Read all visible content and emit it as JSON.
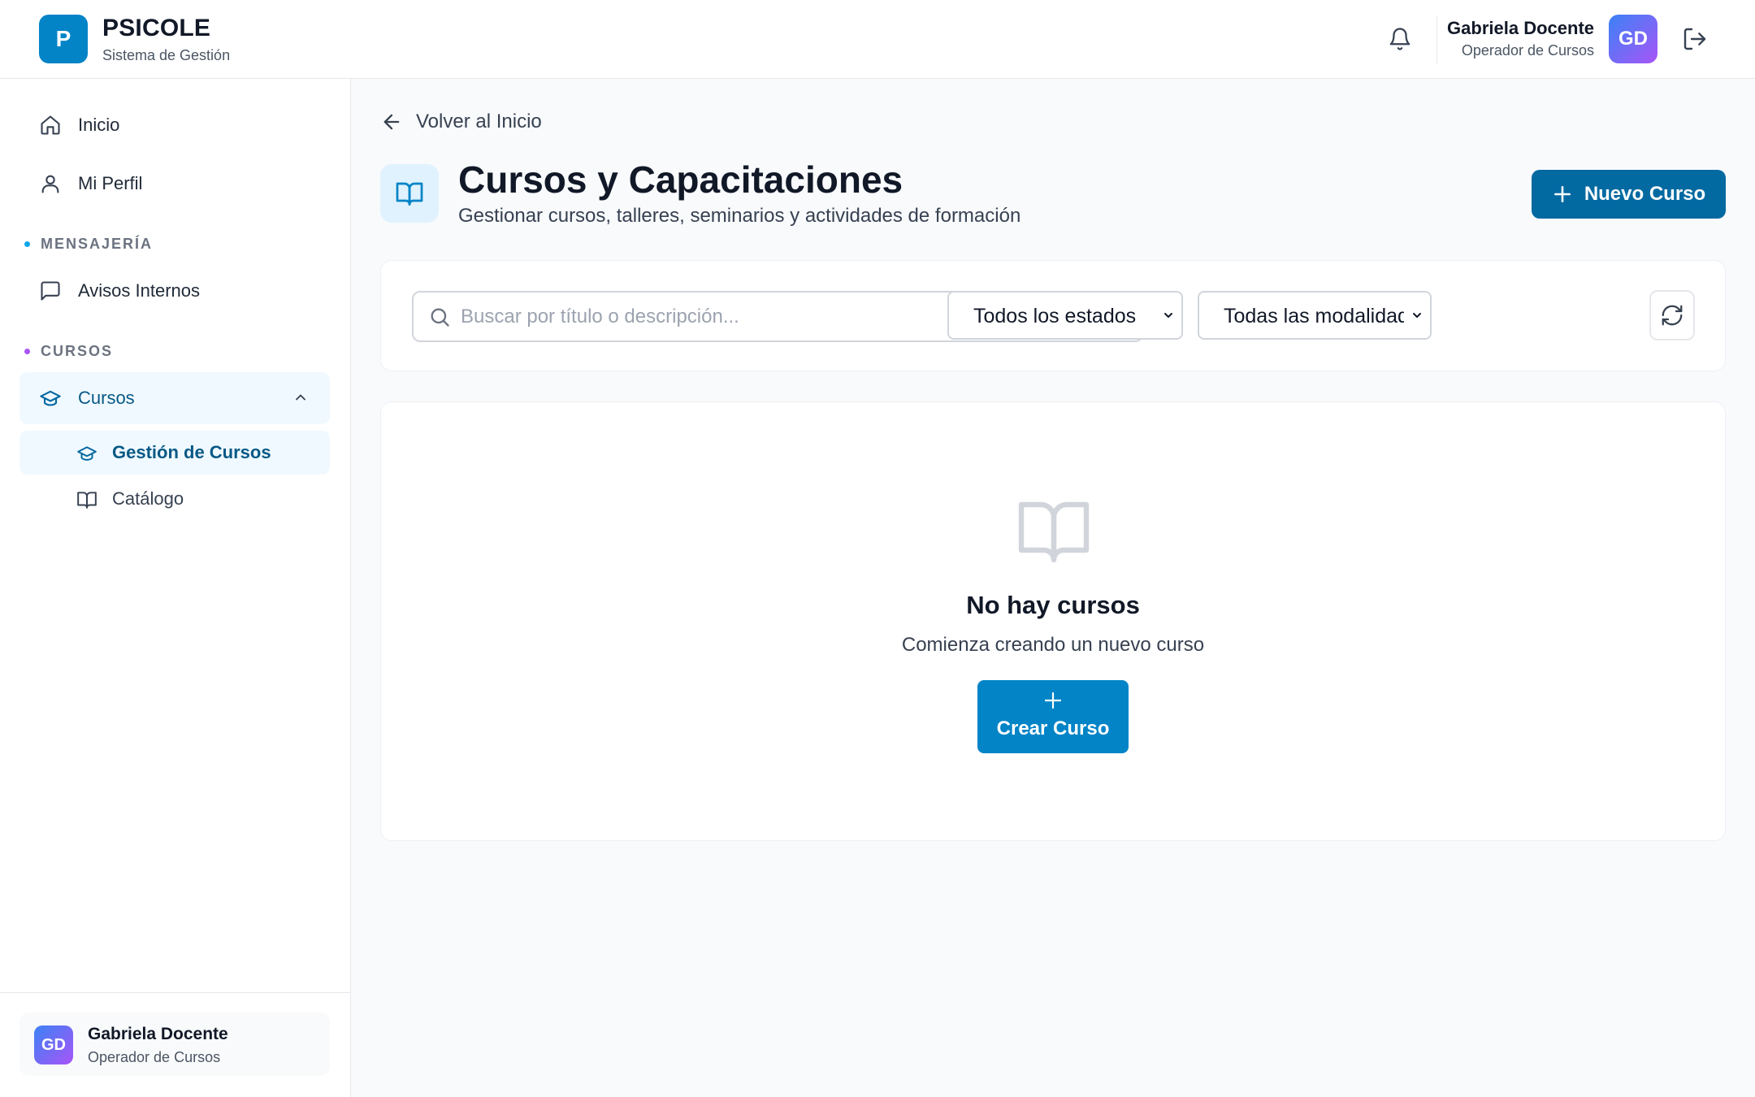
{
  "header": {
    "logo_letter": "P",
    "app_name": "PSICOLE",
    "app_subtitle": "Sistema de Gestión",
    "user_name": "Gabriela Docente",
    "user_role": "Operador de Cursos",
    "user_initials": "GD",
    "icons": [
      "bell-icon",
      "logout-icon"
    ]
  },
  "sidebar": {
    "items": [
      {
        "label": "Inicio",
        "icon": "home-icon"
      },
      {
        "label": "Mi Perfil",
        "icon": "user-icon"
      }
    ],
    "sections": [
      {
        "label": "MENSAJERÍA",
        "dot_color": "#0ea5e9",
        "items": [
          {
            "label": "Avisos Internos",
            "icon": "message-square-icon"
          }
        ]
      },
      {
        "label": "CURSOS",
        "dot_color": "#a855f7",
        "group": {
          "label": "Cursos",
          "icon": "graduation-cap-icon",
          "expanded": true,
          "children": [
            {
              "label": "Gestión de Cursos",
              "icon": "graduation-cap-icon",
              "active": true
            },
            {
              "label": "Catálogo",
              "icon": "book-open-icon",
              "active": false
            }
          ]
        }
      }
    ],
    "footer": {
      "user_initials": "GD",
      "user_name": "Gabriela Docente",
      "user_role": "Operador de Cursos"
    }
  },
  "main": {
    "back_label": "Volver al Inicio",
    "title": "Cursos y Capacitaciones",
    "subtitle": "Gestionar cursos, talleres, seminarios y actividades de formación",
    "new_button_label": "Nuevo Curso",
    "filters": {
      "search_placeholder": "Buscar por título o descripción...",
      "search_value": "",
      "status_select_value": "Todos los estados",
      "modality_select_value": "Todas las modalidades"
    },
    "empty_state": {
      "title": "No hay cursos",
      "description": "Comienza creando un nuevo curso",
      "button_label": "Crear Curso"
    }
  },
  "colors": {
    "primary": "#0284c7",
    "primary_dark": "#0369a1",
    "active_bg": "#f0f9ff",
    "active_text": "#075985",
    "avatar_gradient": [
      "#3b82f6",
      "#a855f7"
    ]
  }
}
